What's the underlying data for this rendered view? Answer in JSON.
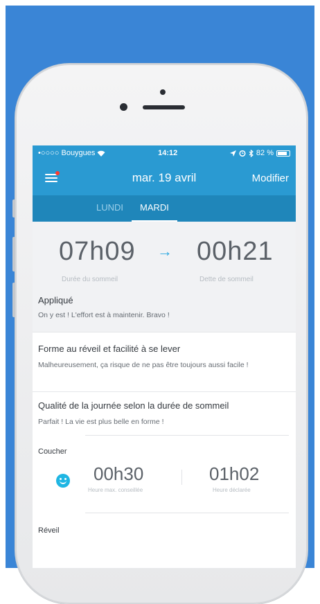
{
  "status_bar": {
    "carrier": "•○○○○ Bouygues",
    "time": "14:12",
    "battery": "82 %",
    "battery_level": 0.82
  },
  "nav": {
    "title": "mar. 19 avril",
    "action": "Modifier"
  },
  "tabs": [
    {
      "label": "LUNDI",
      "active": false
    },
    {
      "label": "MARDI",
      "active": true
    }
  ],
  "summary": {
    "duration_value": "07h09",
    "duration_label": "Durée du sommeil",
    "debt_value": "00h21",
    "debt_label": "Dette de sommeil"
  },
  "sections": [
    {
      "title": "Appliqué",
      "text": "On y est ! L'effort est à maintenir. Bravo !"
    },
    {
      "title": "Forme au réveil et facilité à se lever",
      "text": "Malheureusement, ça risque de ne pas être toujours aussi facile !"
    },
    {
      "title": "Qualité de la journée selon la durée de sommeil",
      "text": "Parfait ! La vie est plus belle en forme !"
    }
  ],
  "coucher": {
    "label": "Coucher",
    "max_value": "00h30",
    "max_label": "Heure max. conseillée",
    "declared_value": "01h02",
    "declared_label": "Heure déclarée"
  },
  "reveil": {
    "label": "Réveil"
  },
  "colors": {
    "brand": "#2a9ad2",
    "tab_bar": "#1f86ba",
    "accent": "#2ba7e0",
    "background": "#3a85d6"
  }
}
